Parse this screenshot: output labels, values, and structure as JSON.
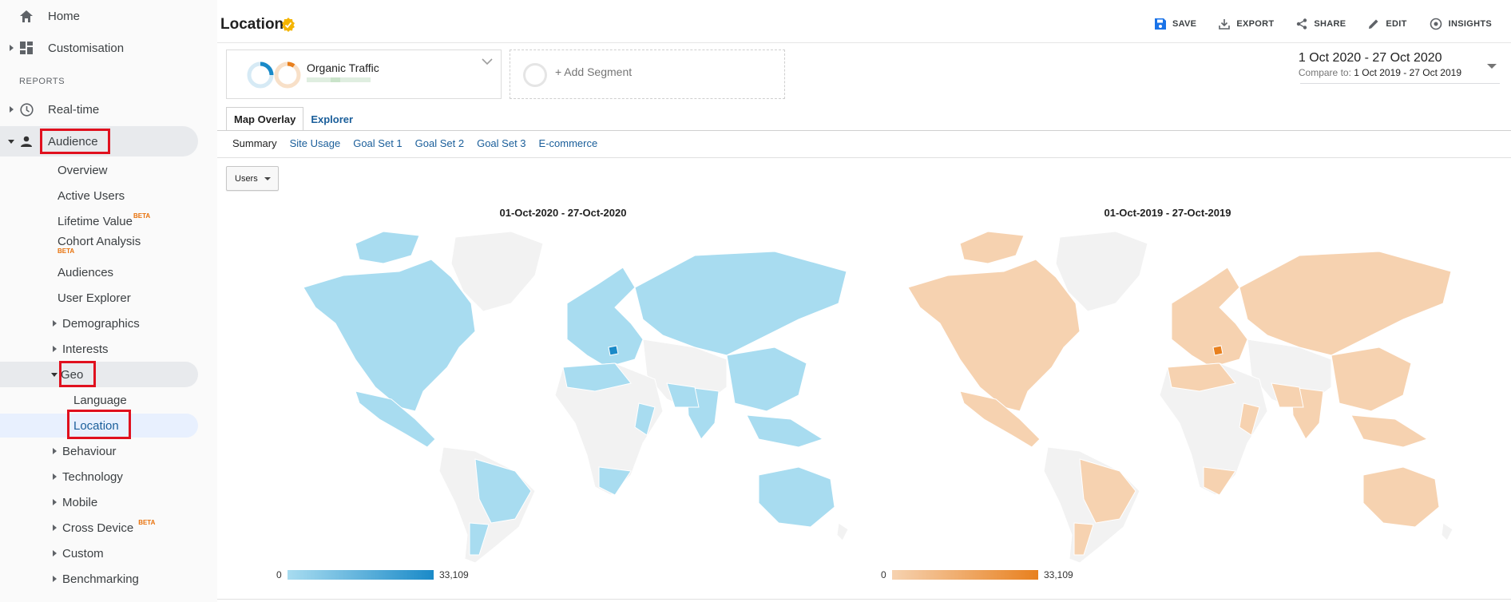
{
  "sidebar": {
    "home": "Home",
    "customisation": "Customisation",
    "reports_label": "REPORTS",
    "realtime": "Real-time",
    "audience": "Audience",
    "items": {
      "overview": "Overview",
      "active_users": "Active Users",
      "lifetime_value": "Lifetime Value",
      "cohort_analysis": "Cohort Analysis",
      "audiences": "Audiences",
      "user_explorer": "User Explorer",
      "demographics": "Demographics",
      "interests": "Interests",
      "geo": "Geo",
      "language": "Language",
      "location": "Location",
      "behaviour": "Behaviour",
      "technology": "Technology",
      "mobile": "Mobile",
      "cross_device": "Cross Device",
      "custom": "Custom",
      "benchmarking": "Benchmarking"
    },
    "beta": "BETA"
  },
  "header": {
    "title": "Location",
    "actions": {
      "save": "SAVE",
      "export": "EXPORT",
      "share": "SHARE",
      "edit": "EDIT",
      "insights": "INSIGHTS"
    }
  },
  "segments": {
    "organic": "Organic Traffic",
    "add": "+ Add Segment"
  },
  "date": {
    "range": "1 Oct 2020 - 27 Oct 2020",
    "compare_label": "Compare to:",
    "compare_range": "1 Oct 2019 - 27 Oct 2019"
  },
  "tabs": {
    "map_overlay": "Map Overlay",
    "explorer": "Explorer"
  },
  "subtabs": {
    "summary": "Summary",
    "site_usage": "Site Usage",
    "goal1": "Goal Set 1",
    "goal2": "Goal Set 2",
    "goal3": "Goal Set 3",
    "ecommerce": "E-commerce"
  },
  "metric_select": "Users",
  "maps": {
    "current": {
      "title": "01-Oct-2020 - 27-Oct-2020",
      "min": "0",
      "max": "33,109",
      "color": "#a8dcf0",
      "strong": "#1a8ac8"
    },
    "previous": {
      "title": "01-Oct-2019 - 27-Oct-2019",
      "min": "0",
      "max": "33,109",
      "color": "#f6d2b0",
      "strong": "#e8801e"
    }
  },
  "colors": {
    "accent": "#1a73e8",
    "highlight": "#e0101e",
    "link": "#1a5e9a"
  }
}
